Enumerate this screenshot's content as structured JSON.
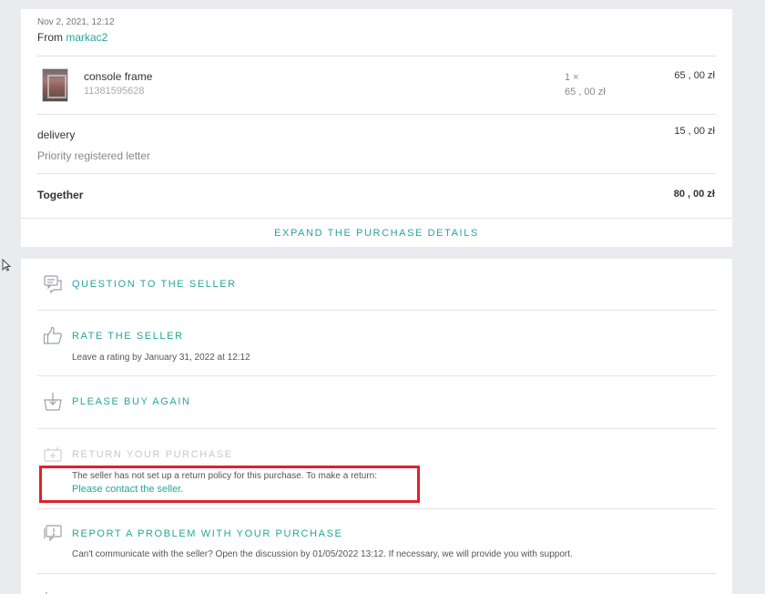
{
  "order": {
    "date": "Nov 2, 2021, 12:12",
    "from_label": "From",
    "seller": "markac2",
    "item": {
      "name": "console frame",
      "id": "11381595628",
      "quantity_line": "1 ×",
      "unit_price": "65 , 00 zł",
      "total": "65 , 00 zł"
    },
    "delivery": {
      "label": "delivery",
      "method": "Priority registered letter",
      "price": "15 , 00 zł"
    },
    "together": {
      "label": "Together",
      "price": "80 , 00 zł"
    },
    "expand_label": "EXPAND THE PURCHASE DETAILS"
  },
  "actions": {
    "question": {
      "title": "QUESTION TO THE SELLER",
      "icon": "chat-icon"
    },
    "rate": {
      "title": "RATE THE SELLER",
      "desc": "Leave a rating by January 31, 2022 at 12:12",
      "icon": "thumbs-up-icon"
    },
    "buy_again": {
      "title": "PLEASE BUY AGAIN",
      "icon": "basket-download-icon"
    },
    "return": {
      "title": "RETURN YOUR PURCHASE",
      "desc": "The seller has not set up a return policy for this purchase. To make a return:",
      "link": "Please contact the seller.",
      "icon": "return-box-icon"
    },
    "report": {
      "title": "REPORT A PROBLEM WITH YOUR PURCHASE",
      "desc": "Can't communicate with the seller? Open the discussion by 01/05/2022 13:12. If necessary, we will provide you with support.",
      "icon": "alert-chat-icon"
    }
  },
  "colors": {
    "accent": "#26a69a",
    "highlight_border": "#e0202a",
    "background": "#e9ebee"
  }
}
